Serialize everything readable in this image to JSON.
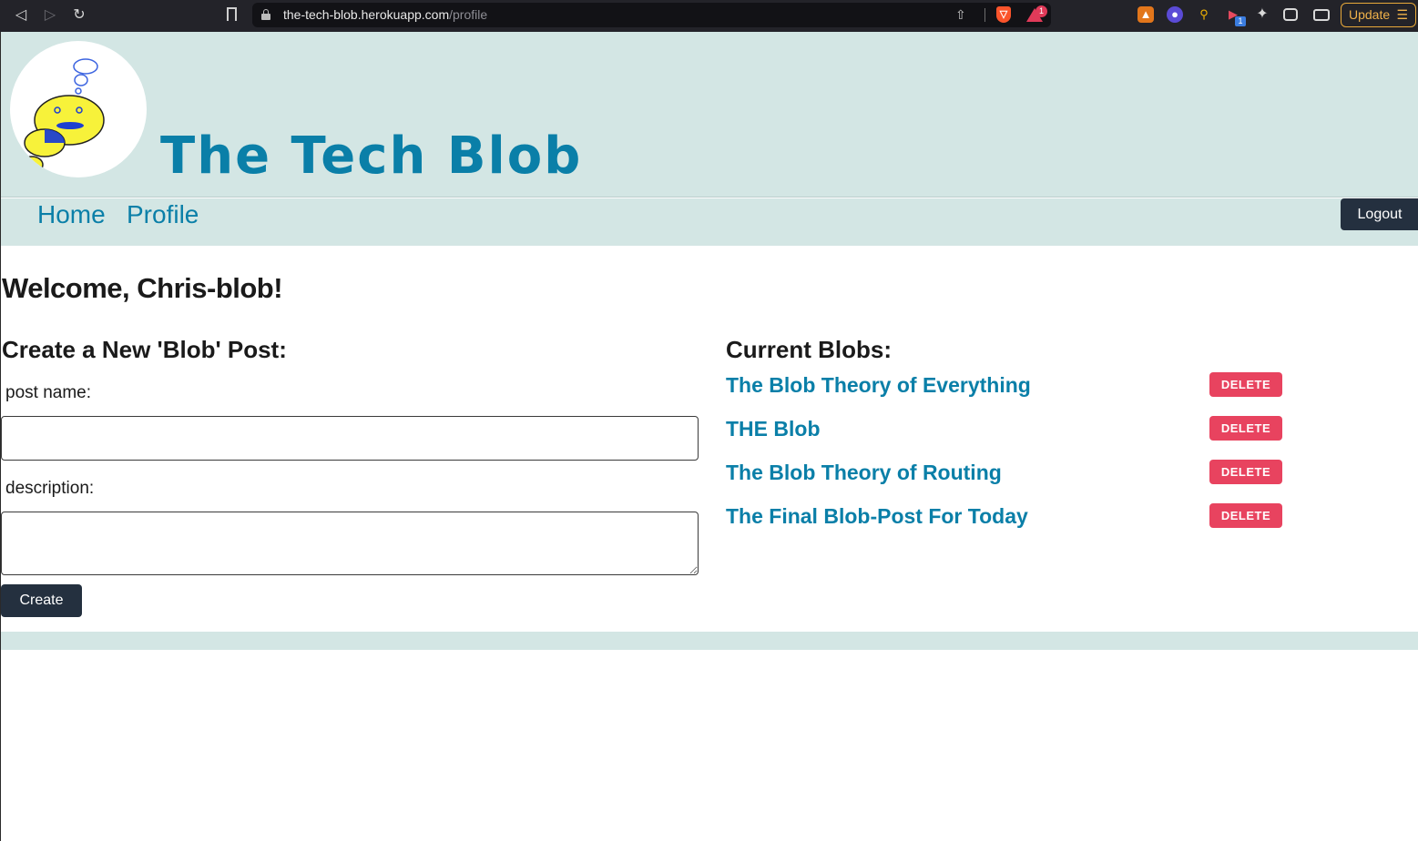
{
  "browser": {
    "url_host": "the-tech-blob.herokuapp.com",
    "url_path": "/profile",
    "update_label": "Update",
    "notification_count": "1",
    "extension_badge": "1"
  },
  "header": {
    "site_title": "The Tech Blob"
  },
  "nav": {
    "home": "Home",
    "profile": "Profile",
    "logout": "Logout"
  },
  "main": {
    "welcome": "Welcome, Chris-blob!",
    "create_heading": "Create a New 'Blob' Post:",
    "post_name_label": "post name:",
    "post_name_value": "",
    "description_label": "description:",
    "description_value": "",
    "create_button": "Create",
    "current_heading": "Current Blobs:",
    "delete_label": "DELETE",
    "posts": [
      {
        "title": "The Blob Theory of Everything"
      },
      {
        "title": "THE Blob"
      },
      {
        "title": "The Blob Theory of Routing"
      },
      {
        "title": "The Final Blob-Post For Today"
      }
    ]
  },
  "colors": {
    "accent": "#0a7fa8",
    "header_bg": "#d3e6e4",
    "dark_button": "#24303f",
    "delete_button": "#e8435f"
  }
}
